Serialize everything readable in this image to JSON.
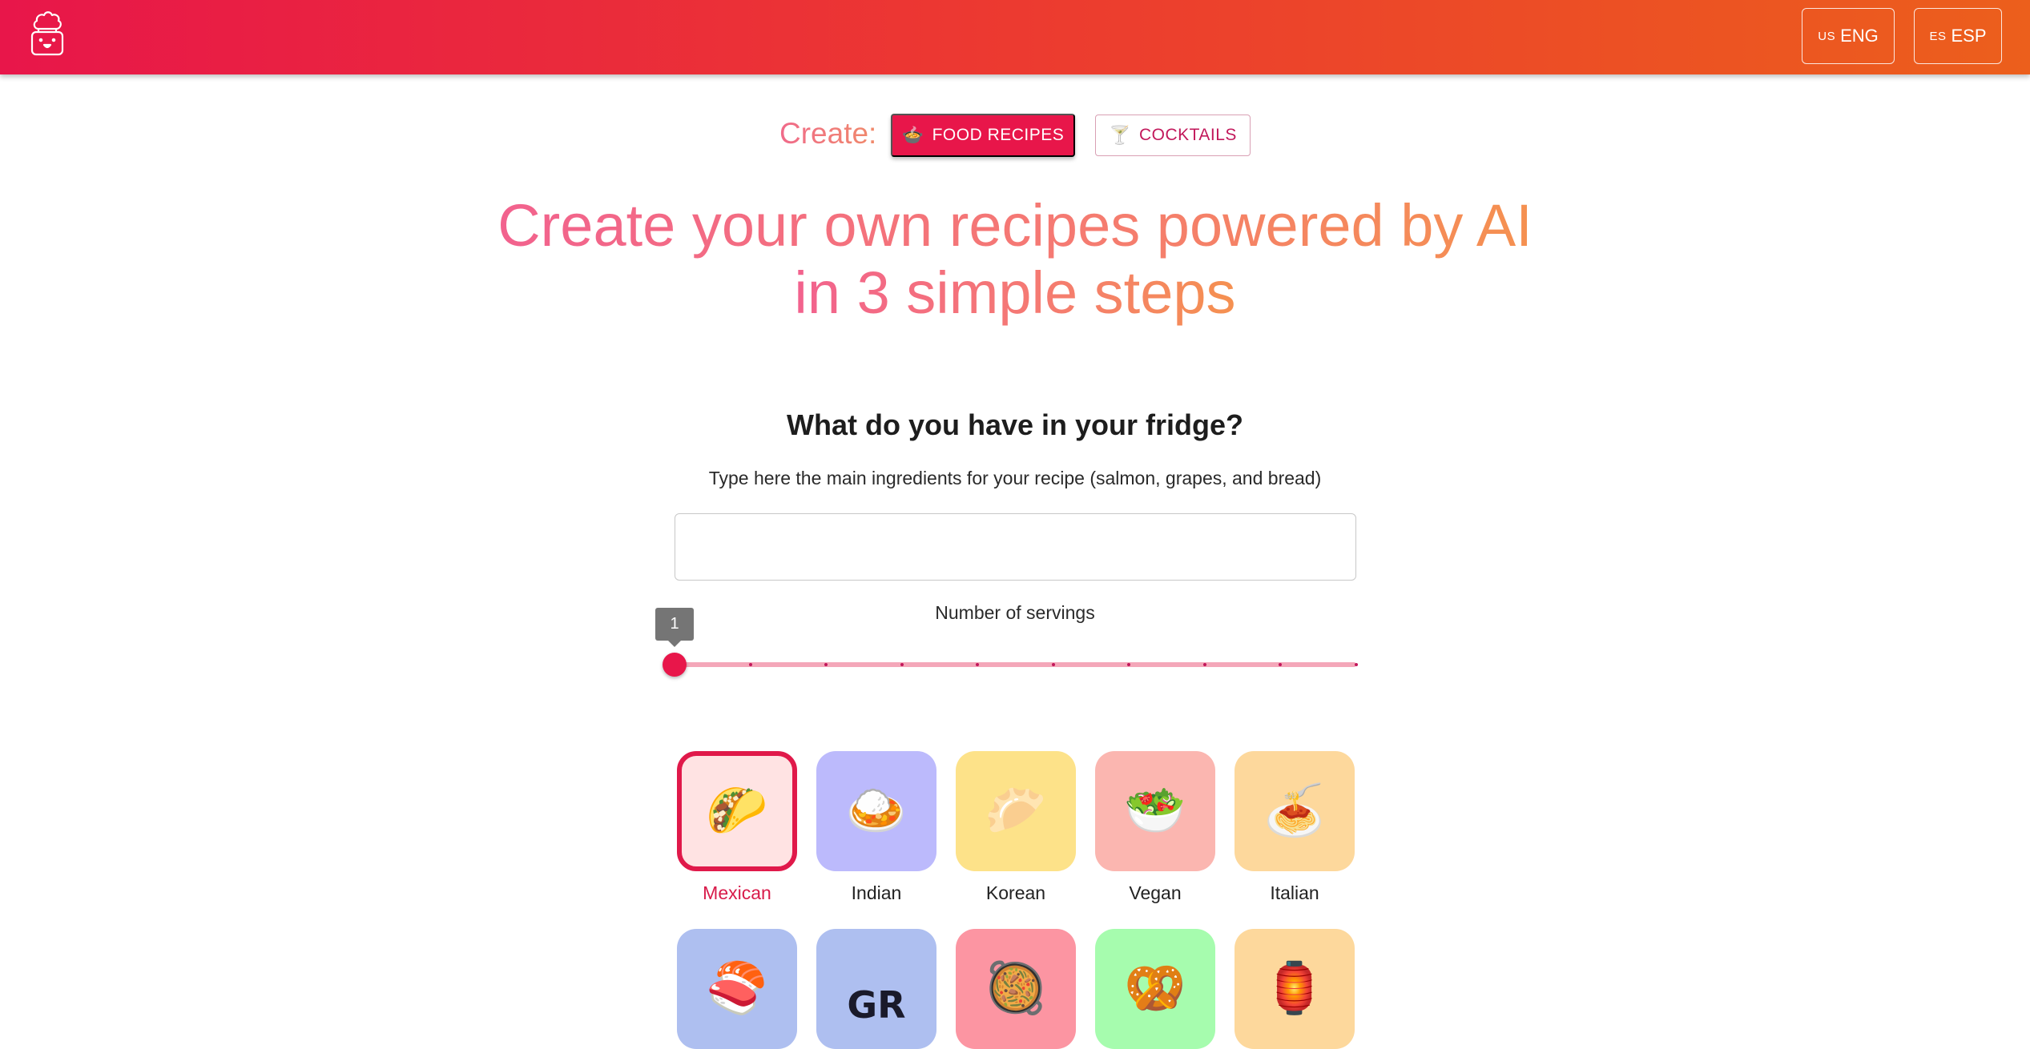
{
  "header": {
    "logo_icon": "chef-hat-face-icon",
    "languages": [
      {
        "flag": "US",
        "label": "ENG"
      },
      {
        "flag": "ES",
        "label": "ESP"
      }
    ],
    "gradient": [
      "#e8164a",
      "#ec5f1c"
    ]
  },
  "create": {
    "label": "Create:",
    "modes": [
      {
        "icon": "🍲",
        "label": "FOOD RECIPES",
        "active": true
      },
      {
        "icon": "🍸",
        "label": "COCKTAILS",
        "active": false
      }
    ]
  },
  "hero": {
    "line1": "Create your own recipes powered by AI",
    "line2": "in 3 simple steps"
  },
  "fridge": {
    "title": "What do you have in your fridge?",
    "subtitle": "Type here the main ingredients for your recipe (salmon, grapes, and bread)",
    "input_value": "",
    "input_placeholder": ""
  },
  "servings": {
    "label": "Number of servings",
    "value": 1,
    "min": 1,
    "max": 10,
    "tooltip": "1"
  },
  "cuisines": [
    {
      "label": "Mexican",
      "icon": "🌮",
      "color": "#ffe3e3",
      "selected": true
    },
    {
      "label": "Indian",
      "icon": "🍛",
      "color": "#bcbafc",
      "selected": false
    },
    {
      "label": "Korean",
      "icon": "🥟",
      "color": "#fde289",
      "selected": false
    },
    {
      "label": "Vegan",
      "icon": "🥗",
      "color": "#fbb6b0",
      "selected": false
    },
    {
      "label": "Italian",
      "icon": "🍝",
      "color": "#fdd89c",
      "selected": false
    },
    {
      "label": "",
      "icon": "🍣",
      "color": "#aebff0",
      "selected": false
    },
    {
      "label": "",
      "icon": "GR",
      "color": "#aebff0",
      "selected": false
    },
    {
      "label": "",
      "icon": "🥘",
      "color": "#fc95a2",
      "selected": false
    },
    {
      "label": "",
      "icon": "🥨",
      "color": "#a6fcae",
      "selected": false
    },
    {
      "label": "",
      "icon": "🏮",
      "color": "#fdd89c",
      "selected": false
    }
  ]
}
